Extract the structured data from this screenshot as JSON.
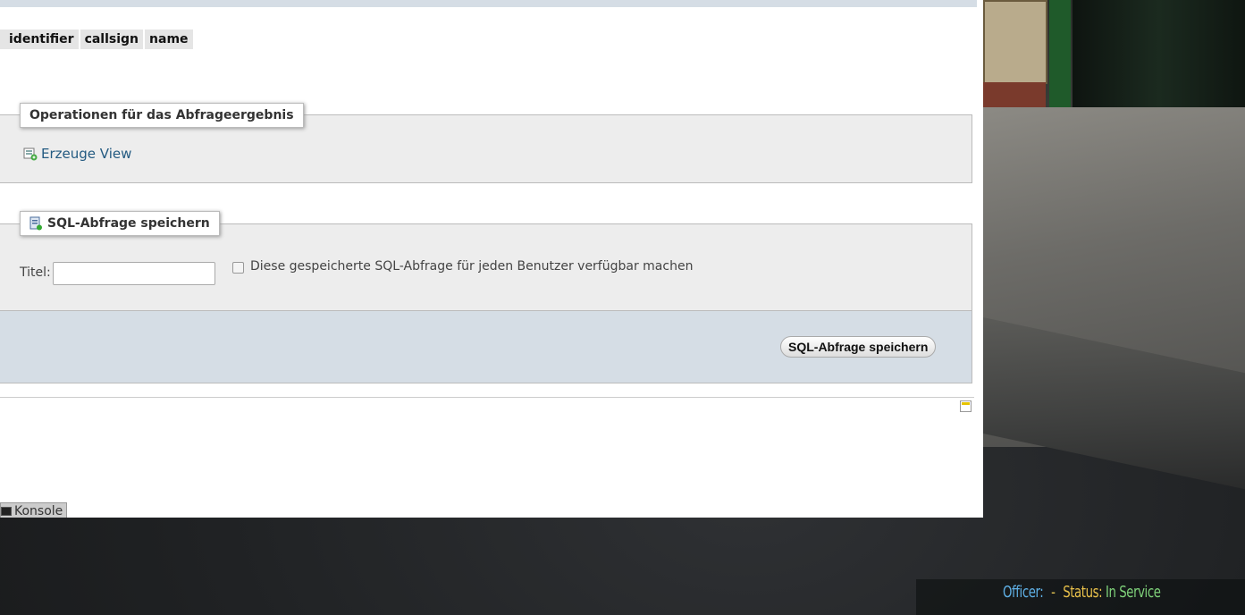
{
  "table": {
    "headers": [
      "identifier",
      "callsign",
      "name"
    ]
  },
  "operations": {
    "legend": "Operationen für das Abfrageergebnis",
    "create_view": "Erzeuge View"
  },
  "save_query": {
    "legend": "SQL-Abfrage speichern",
    "title_label": "Titel:",
    "title_value": "",
    "share_label": "Diese gespeicherte SQL-Abfrage für jeden Benutzer verfügbar machen",
    "share_checked": false,
    "submit_label": "SQL-Abfrage speichern"
  },
  "console": {
    "label": "Konsole"
  },
  "hud": {
    "officer_label": "Officer:",
    "officer_value": "-",
    "status_label": "Status:",
    "status_value": "In Service"
  },
  "colors": {
    "link": "#235a81",
    "hud_officer": "#5fb0e6",
    "hud_status": "#e8c04a",
    "hud_value": "#7fd27a"
  }
}
